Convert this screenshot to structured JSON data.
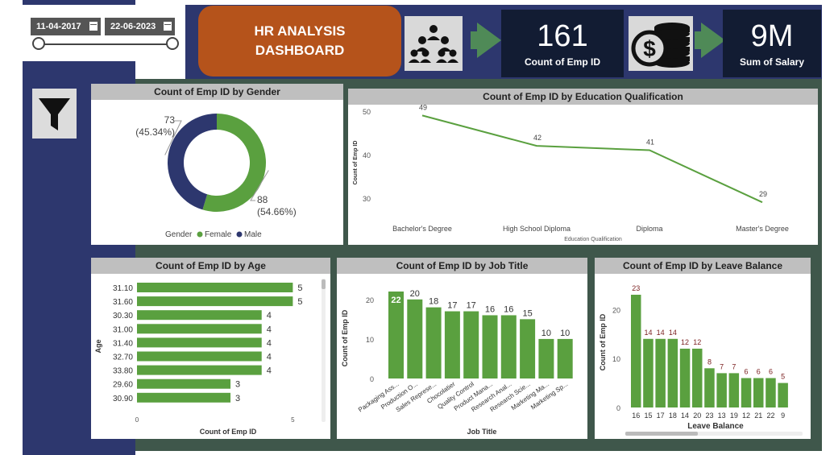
{
  "date_filter": {
    "start": "11-04-2017",
    "end": "22-06-2023"
  },
  "title": {
    "line1": "HR ANALYSIS",
    "line2": "DASHBOARD"
  },
  "kpis": [
    {
      "value": "161",
      "label": "Count of Emp ID"
    },
    {
      "value": "9M",
      "label": "Sum of Salary"
    }
  ],
  "icons": {
    "employees": "employees-group-icon",
    "salary": "coins-dollar-icon",
    "filter": "filter-funnel-icon"
  },
  "colors": {
    "green": "#5aa03f",
    "navy": "#2d376e",
    "orange": "#b5531b"
  },
  "chart_data": [
    {
      "type": "pie",
      "title": "Count of Emp ID by Gender",
      "legend_title": "Gender",
      "legend_position": "bottom",
      "slices": [
        {
          "name": "Female",
          "value": 88,
          "label": "88",
          "pct": "(54.66%)",
          "color": "#5aa03f"
        },
        {
          "name": "Male",
          "value": 73,
          "label": "73",
          "pct": "(45.34%)",
          "color": "#2d376e"
        }
      ]
    },
    {
      "type": "line",
      "title": "Count of Emp ID by Education Qualification",
      "xlabel": "Education Qualification",
      "ylabel": "Count of Emp ID",
      "categories": [
        "Bachelor's Degree",
        "High School Diploma",
        "Diploma",
        "Master's Degree"
      ],
      "values": [
        49,
        42,
        41,
        29
      ],
      "yticks": [
        30,
        40,
        50
      ],
      "ylim": [
        27,
        50
      ]
    },
    {
      "type": "bar",
      "orientation": "horizontal",
      "title": "Count of Emp ID by Age",
      "xlabel": "Count of Emp ID",
      "ylabel": "Age",
      "categories": [
        "31.10",
        "31.60",
        "30.30",
        "31.00",
        "31.40",
        "32.70",
        "33.80",
        "29.60",
        "30.90"
      ],
      "values": [
        5,
        5,
        4,
        4,
        4,
        4,
        4,
        3,
        3
      ],
      "xticks": [
        0,
        5
      ],
      "xlim": [
        0,
        5.3
      ]
    },
    {
      "type": "bar",
      "title": "Count of Emp ID by Job Title",
      "xlabel": "Job Title",
      "ylabel": "Count of Emp ID",
      "categories": [
        "Packaging Ass...",
        "Production O...",
        "Sales Represe...",
        "Chocolatier",
        "Quality Control",
        "Product Mana...",
        "Research Anal...",
        "Research Scie...",
        "Marketing Ma...",
        "Marketing Sp..."
      ],
      "values": [
        22,
        20,
        18,
        17,
        17,
        16,
        16,
        15,
        10,
        10
      ],
      "yticks": [
        0,
        10,
        20
      ],
      "ylim": [
        0,
        22
      ]
    },
    {
      "type": "bar",
      "title": "Count of Emp ID by Leave Balance",
      "xlabel": "Leave Balance",
      "ylabel": "Count of Emp ID",
      "categories": [
        "16",
        "15",
        "17",
        "18",
        "14",
        "20",
        "23",
        "13",
        "19",
        "12",
        "21",
        "22",
        "9"
      ],
      "values": [
        23,
        14,
        14,
        14,
        12,
        12,
        8,
        7,
        7,
        6,
        6,
        6,
        5
      ],
      "yticks": [
        0,
        10,
        20
      ],
      "ylim": [
        0,
        23
      ]
    }
  ]
}
